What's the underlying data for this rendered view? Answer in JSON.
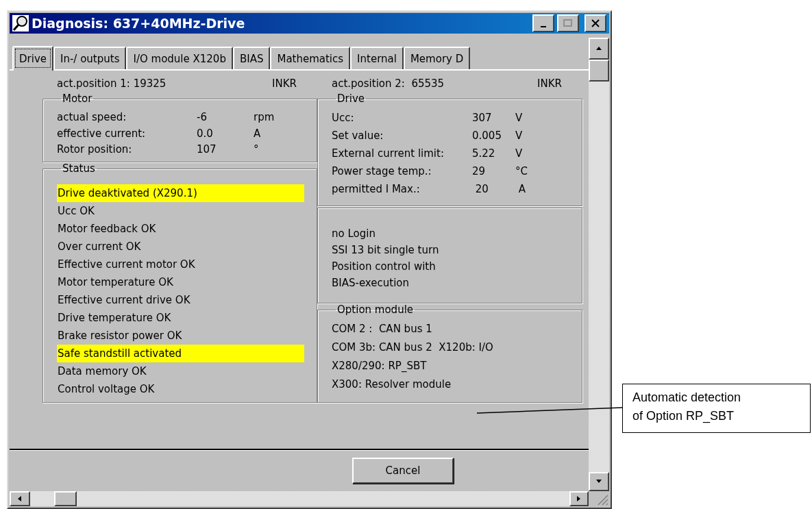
{
  "window": {
    "title": "Diagnosis: 637+40MHz-Drive"
  },
  "tabs": [
    {
      "label": "Drive",
      "selected": true
    },
    {
      "label": "In-/ outputs",
      "selected": false
    },
    {
      "label": "I/O module X120b",
      "selected": false
    },
    {
      "label": "BIAS",
      "selected": false
    },
    {
      "label": "Mathematics",
      "selected": false
    },
    {
      "label": "Internal",
      "selected": false
    },
    {
      "label": "Memory D",
      "selected": false
    }
  ],
  "positions": [
    {
      "label": "act.position 1: 19325",
      "unit": "INKR"
    },
    {
      "label": "act.position 2:  65535",
      "unit": "INKR"
    }
  ],
  "motor": {
    "title": "Motor",
    "rows": [
      {
        "name": "actual speed:",
        "value": "-6",
        "unit": "rpm"
      },
      {
        "name": "effective current:",
        "value": "0.0",
        "unit": "A"
      },
      {
        "name": "Rotor position:",
        "value": "107",
        "unit": "°"
      }
    ]
  },
  "status": {
    "title": "Status",
    "items": [
      {
        "text": "Drive deaktivated (X290.1)",
        "highlighted": true
      },
      {
        "text": "Ucc OK",
        "highlighted": false
      },
      {
        "text": "Motor feedback OK",
        "highlighted": false
      },
      {
        "text": "Over current OK",
        "highlighted": false
      },
      {
        "text": "Effective current motor OK",
        "highlighted": false
      },
      {
        "text": "Motor temperature OK",
        "highlighted": false
      },
      {
        "text": "Effective current drive OK",
        "highlighted": false
      },
      {
        "text": "Drive temperature OK",
        "highlighted": false
      },
      {
        "text": "Brake resistor power OK",
        "highlighted": false
      },
      {
        "text": "Safe standstill activated",
        "highlighted": true
      },
      {
        "text": "Data memory OK",
        "highlighted": false
      },
      {
        "text": "Control voltage OK",
        "highlighted": false
      }
    ]
  },
  "drive": {
    "title": "Drive",
    "rows": [
      {
        "name": "Ucc:",
        "value": "307",
        "unit": "V"
      },
      {
        "name": "Set value:",
        "value": "0.005",
        "unit": "V"
      },
      {
        "name": "External current limit:",
        "value": "5.22",
        "unit": "V"
      },
      {
        "name": "Power stage temp.:",
        "value": "29",
        "unit": "°C"
      },
      {
        "name": "permitted I Max.:",
        "value": " 20",
        "unit": " A"
      }
    ]
  },
  "info_lines": [
    "no Login",
    "SSI 13 bit single turn",
    "Position control with",
    "BIAS-execution"
  ],
  "option_module": {
    "title": "Option module",
    "lines": [
      "COM 2 :  CAN bus 1",
      "COM 3b: CAN bus 2  X120b: I/O",
      "X280/290: RP_SBT",
      "X300: Resolver module"
    ]
  },
  "buttons": [
    "Cancel"
  ],
  "callout": {
    "text": "Automatic detection\nof Option RP_SBT"
  }
}
